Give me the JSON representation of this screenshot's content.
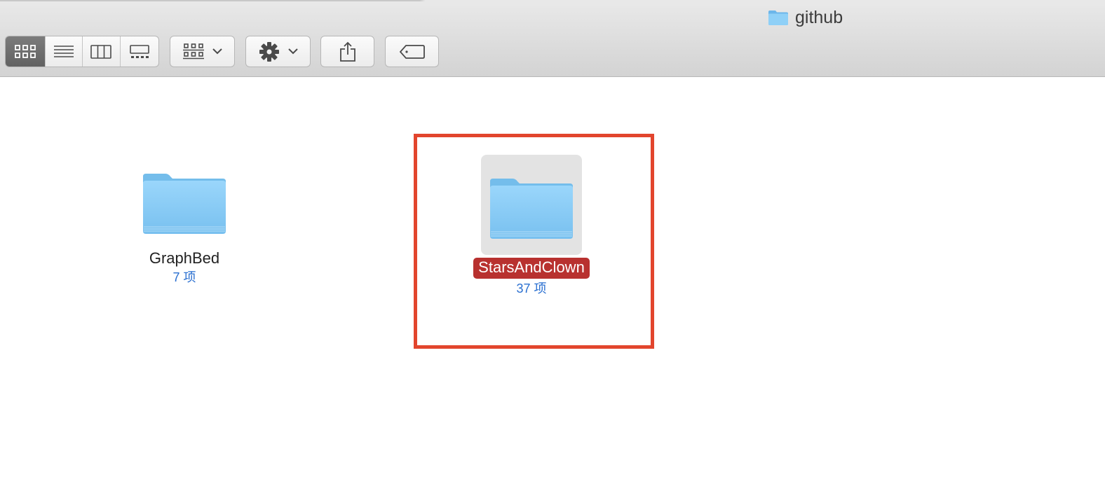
{
  "window": {
    "title": "github",
    "folder_icon": "folder-icon"
  },
  "toolbar": {
    "view_modes": [
      {
        "name": "icon-view",
        "icon": "grid-icon",
        "active": true
      },
      {
        "name": "list-view",
        "icon": "list-icon",
        "active": false
      },
      {
        "name": "column-view",
        "icon": "columns-icon",
        "active": false
      },
      {
        "name": "gallery-view",
        "icon": "gallery-icon",
        "active": false
      }
    ],
    "group_button_icon": "group-icon",
    "action_button_icon": "gear-icon",
    "share_button_icon": "share-icon",
    "tag_button_icon": "tag-icon"
  },
  "items": [
    {
      "name": "GraphBed",
      "count": "7 项",
      "selected": false
    },
    {
      "name": "StarsAndClown",
      "count": "37 项",
      "selected": true
    }
  ],
  "colors": {
    "folder_blue": "#84c8f4",
    "selection_red": "#b8312f",
    "highlight_box": "#e2452d",
    "count_text": "#2a6fd0"
  }
}
